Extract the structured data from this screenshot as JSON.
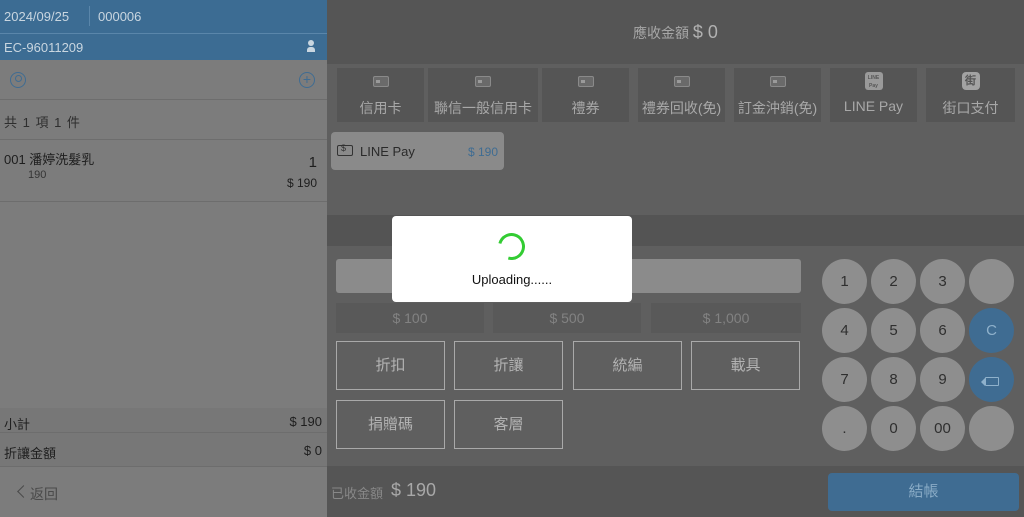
{
  "header": {
    "date": "2024/09/25",
    "order_no": "000006",
    "customer_id": "EC-96011209"
  },
  "cart": {
    "summary": "共 1 項 1 件",
    "items": [
      {
        "name": "001 潘婷洗髮乳",
        "qty": "1",
        "unit_price": "190",
        "subtotal": "$ 190"
      }
    ],
    "subtotal_label": "小計",
    "subtotal_value": "$ 190",
    "discount_label": "折讓金額",
    "discount_value": "$ 0",
    "back_label": "返回"
  },
  "receivable": {
    "label": "應收金額",
    "value": "$ 0"
  },
  "payment_methods": [
    {
      "label": "信用卡",
      "icon": "card-icon"
    },
    {
      "label": "聯信一般信用卡",
      "icon": "card-icon"
    },
    {
      "label": "禮券",
      "icon": "voucher-icon"
    },
    {
      "label": "禮券回收(免)",
      "icon": "voucher-icon"
    },
    {
      "label": "訂金沖銷(免)",
      "icon": "voucher-icon"
    },
    {
      "label": "LINE Pay",
      "icon": "line-pay-icon",
      "icon_text": "LINE Pay"
    },
    {
      "label": "街口支付",
      "icon": "jkopay-icon",
      "icon_text": "街"
    }
  ],
  "applied_payment": {
    "name": "LINE Pay",
    "amount": "$ 190"
  },
  "quick_amounts": [
    "$ 100",
    "$ 500",
    "$ 1,000"
  ],
  "actions": [
    "折扣",
    "折讓",
    "統編",
    "載具",
    "捐贈碼",
    "客層"
  ],
  "keypad": {
    "row1": [
      "1",
      "2",
      "3",
      ""
    ],
    "row2": [
      "4",
      "5",
      "6",
      "C"
    ],
    "row3": [
      "7",
      "8",
      "9",
      "⌫"
    ],
    "row4": [
      ".",
      "0",
      "00",
      ""
    ]
  },
  "received": {
    "label": "已收金額",
    "value": "$ 190"
  },
  "checkout_label": "結帳",
  "modal": {
    "message": "Uploading......"
  },
  "colors": {
    "accent": "#3f6c92",
    "spinner": "#33cc33"
  }
}
